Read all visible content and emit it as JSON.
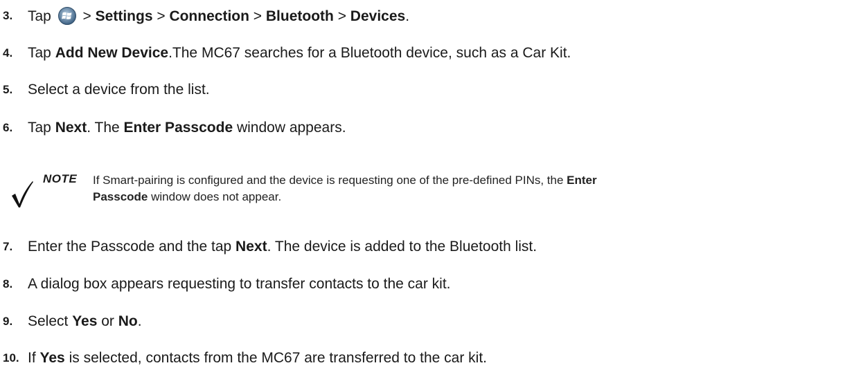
{
  "steps": [
    {
      "num": "3.",
      "p1": "Tap",
      "p2": " > ",
      "settings": "Settings",
      "p3": " > ",
      "connection": "Connection",
      "p4": " > ",
      "bluetooth": "Bluetooth",
      "p5": " > ",
      "devices": "Devices",
      "p6": "."
    },
    {
      "num": "4.",
      "p1": "Tap ",
      "b1": "Add New Device",
      "p2": ".The MC67 searches for a Bluetooth device, such as a Car Kit."
    },
    {
      "num": "5.",
      "p1": "Select a device from the list."
    },
    {
      "num": "6.",
      "p1": "Tap ",
      "b1": "Next",
      "p2": ". The ",
      "b2": "Enter Passcode",
      "p3": " window appears."
    },
    {
      "num": "7.",
      "p1": "Enter the Passcode and the tap ",
      "b1": "Next",
      "p2": ". The device is added to the Bluetooth list."
    },
    {
      "num": "8.",
      "p1": "A dialog box appears requesting to transfer contacts to the car kit."
    },
    {
      "num": "9.",
      "p1": "Select ",
      "b1": "Yes",
      "p2": " or ",
      "b2": "No",
      "p3": "."
    },
    {
      "num": "10.",
      "p1": "If ",
      "b1": "Yes",
      "p2": " is selected, contacts from the MC67 are transferred to the car kit."
    }
  ],
  "note": {
    "label": "NOTE",
    "t1": "If Smart-pairing is configured and the device is requesting one of the pre-defined PINs, the ",
    "b1": "Enter",
    "t2": "Passcode",
    "t3": " window does not appear."
  },
  "icons": {
    "start": "windows-start-icon",
    "check": "checkmark-icon"
  }
}
